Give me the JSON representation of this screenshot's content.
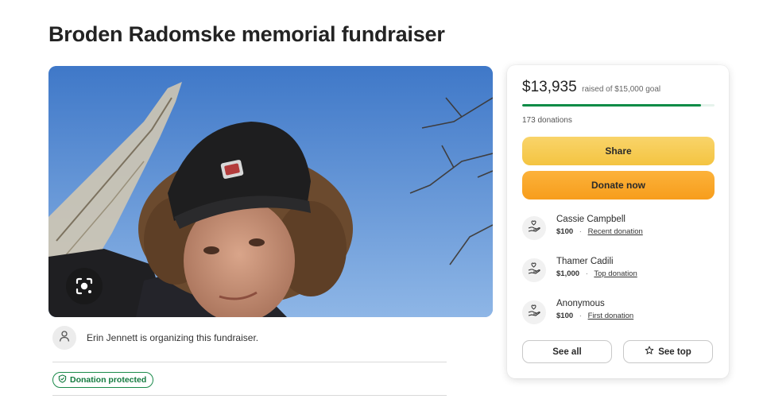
{
  "page": {
    "title": "Broden Radomske memorial fundraiser"
  },
  "organizer": {
    "text": "Erin Jennett is organizing this fundraiser."
  },
  "badge": {
    "protected_label": "Donation protected"
  },
  "campaign": {
    "raised": "$13,935",
    "goal_text": "raised of $15,000 goal",
    "progress_fraction": 0.929,
    "donation_count": "173 donations",
    "share_label": "Share",
    "donate_label": "Donate now",
    "see_all_label": "See all",
    "see_top_label": "See top"
  },
  "donors": [
    {
      "name": "Cassie Campbell",
      "amount": "$100",
      "separator": "·",
      "kind": "Recent donation"
    },
    {
      "name": "Thamer Cadili",
      "amount": "$1,000",
      "separator": "·",
      "kind": "Top donation"
    },
    {
      "name": "Anonymous",
      "amount": "$100",
      "separator": "·",
      "kind": "First donation"
    }
  ],
  "icons": {
    "lens": "camera-lens-icon",
    "organizer": "person-icon",
    "shield": "shield-icon",
    "donor": "hand-heart-icon",
    "star": "star-icon"
  },
  "colors": {
    "progress": "#0a8b46",
    "share": "#f6c94f",
    "donate": "#f8a424",
    "protected": "#127a3e"
  }
}
